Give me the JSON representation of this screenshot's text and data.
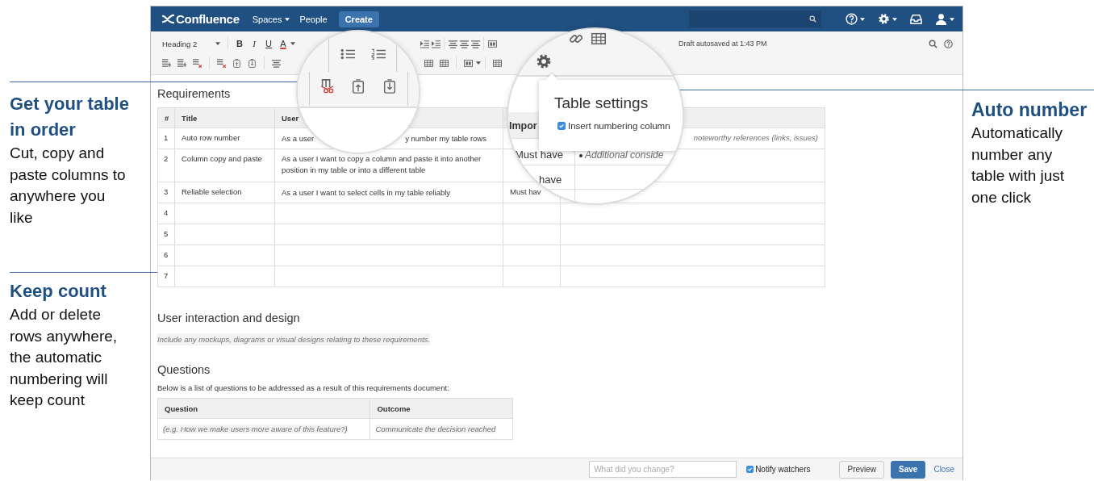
{
  "callouts_left": [
    {
      "title": "Get your table in order",
      "body": "Cut, copy and paste columns to anywhere you like"
    },
    {
      "title": "Keep count",
      "body": "Add or delete rows anywhere, the automatic numbering will keep count"
    }
  ],
  "callouts_right": [
    {
      "title": "Auto number",
      "body": "Automatically number any table with just one click"
    }
  ],
  "topbar": {
    "logo": "Confluence",
    "nav": [
      {
        "label": "Spaces",
        "kind": "menu"
      },
      {
        "label": "People",
        "kind": "link"
      },
      {
        "label": "Create",
        "kind": "button"
      }
    ]
  },
  "toolbar": {
    "style_select": "Heading 2",
    "format_buttons": [
      {
        "label": "B",
        "kind": "bold"
      },
      {
        "label": "I",
        "kind": "italic"
      },
      {
        "label": "U",
        "kind": "underline"
      },
      {
        "label": "A",
        "kind": "color"
      }
    ],
    "status": "Draft autosaved at 1:43 PM"
  },
  "content": {
    "heading": "Requirements",
    "table": {
      "columns": [
        "#",
        "Title",
        "User"
      ],
      "rows": [
        {
          "number": "1",
          "title": "Auto row number",
          "story": [
            "As a user",
            "y number my table rows"
          ],
          "notes": "noteworthy references (links, issues)"
        },
        {
          "number": "2",
          "title": "Column copy and paste",
          "story": [
            "As a user I want to copy a column and paste it into another position in my table or into a different table"
          ]
        },
        {
          "number": "3",
          "title": "Reliable selection",
          "story": [
            "As a user I want to select cells in my table reliably"
          ],
          "importance": "Must hav"
        },
        {
          "number": "4"
        },
        {
          "number": "5"
        },
        {
          "number": "6"
        },
        {
          "number": "7"
        }
      ]
    },
    "design_heading": "User interaction and design",
    "design_hint": "Include any mockups, diagrams or visual designs relating to these requirements.",
    "questions_heading": "Questions",
    "questions_intro": "Below is a list of questions to be addressed as a result of this requirements document:",
    "questions_table": {
      "columns": [
        "Question",
        "Outcome"
      ],
      "rows": [
        [
          "(e.g. How we make users more aware of this feature?)",
          "Communicate the decision reached"
        ]
      ]
    }
  },
  "magnifier": {
    "popup": {
      "title": "Table settings",
      "option": {
        "label": "Insert numbering column",
        "checked": true
      }
    },
    "header": "Impor",
    "cells": [
      "Must have",
      "have"
    ],
    "bullet": "Additional conside"
  },
  "footer": {
    "comment": {
      "placeholder": "What did you change?"
    },
    "notify": {
      "label": "Notify watchers",
      "checked": true
    },
    "buttons": [
      {
        "label": "Preview",
        "kind": "secondary"
      },
      {
        "label": "Save",
        "kind": "primary"
      },
      {
        "label": "Close",
        "kind": "link"
      }
    ]
  }
}
